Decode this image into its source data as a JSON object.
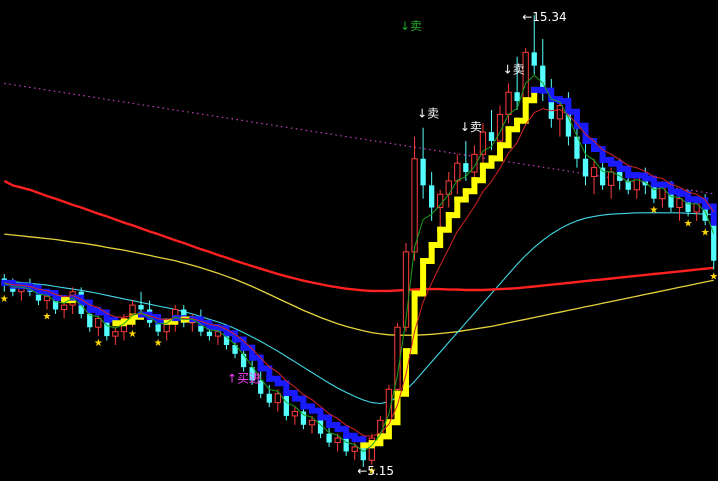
{
  "chart_data": {
    "type": "candlestick",
    "title": "",
    "xlabel": "",
    "ylabel": "",
    "grid": false,
    "axes_visible": false,
    "price_range": [
      4.9,
      15.5
    ],
    "colors": {
      "background": "#000000",
      "up_candle": "#ff3b3b",
      "down_candle": "#54ffff",
      "ma_red": "#ff2020",
      "ma_yellow": "#e6d23c",
      "ma_cyan": "#40d8e8",
      "ma_thin_red": "#d42424",
      "ma_green": "#1aa01a",
      "ma_magenta_dotted": "#c040c0",
      "trail_up": "#ffff00",
      "trail_down": "#1a1aff",
      "star": "#ffd700",
      "sell_signal_white": "#ffffff",
      "sell_signal_green": "#22aa22",
      "buy_signal": "#ff40ff"
    },
    "annotations": {
      "high_label": "15.34",
      "low_label": "5.15",
      "buy_label": "买进",
      "sell_label": "卖"
    },
    "candles": [
      [
        9.4,
        9.5,
        9.1,
        9.3
      ],
      [
        9.3,
        9.4,
        9.0,
        9.1
      ],
      [
        9.1,
        9.3,
        8.9,
        9.2
      ],
      [
        9.2,
        9.4,
        9.0,
        9.1
      ],
      [
        9.1,
        9.2,
        8.8,
        8.9
      ],
      [
        8.9,
        9.1,
        8.7,
        9.0
      ],
      [
        9.0,
        9.1,
        8.6,
        8.7
      ],
      [
        8.7,
        8.9,
        8.5,
        8.8
      ],
      [
        8.8,
        9.2,
        8.6,
        9.1
      ],
      [
        9.1,
        9.2,
        8.5,
        8.6
      ],
      [
        8.6,
        8.8,
        8.2,
        8.3
      ],
      [
        8.3,
        8.6,
        8.1,
        8.5
      ],
      [
        8.5,
        8.7,
        8.0,
        8.1
      ],
      [
        8.1,
        8.3,
        7.9,
        8.2
      ],
      [
        8.2,
        8.6,
        8.0,
        8.5
      ],
      [
        8.5,
        8.9,
        8.3,
        8.8
      ],
      [
        8.8,
        9.1,
        8.6,
        8.7
      ],
      [
        8.7,
        8.9,
        8.3,
        8.4
      ],
      [
        8.4,
        8.6,
        8.1,
        8.2
      ],
      [
        8.2,
        8.5,
        8.0,
        8.4
      ],
      [
        8.4,
        8.8,
        8.2,
        8.7
      ],
      [
        8.7,
        8.8,
        8.3,
        8.4
      ],
      [
        8.4,
        8.6,
        8.2,
        8.5
      ],
      [
        8.5,
        8.7,
        8.1,
        8.2
      ],
      [
        8.2,
        8.4,
        8.0,
        8.1
      ],
      [
        8.1,
        8.3,
        7.9,
        8.2
      ],
      [
        8.2,
        8.3,
        7.8,
        7.9
      ],
      [
        7.9,
        8.1,
        7.6,
        7.7
      ],
      [
        7.7,
        7.9,
        7.3,
        7.4
      ],
      [
        7.4,
        7.6,
        7.0,
        7.1
      ],
      [
        7.1,
        7.3,
        6.7,
        6.8
      ],
      [
        6.8,
        7.0,
        6.5,
        6.6
      ],
      [
        6.6,
        6.9,
        6.4,
        6.8
      ],
      [
        6.8,
        6.9,
        6.2,
        6.3
      ],
      [
        6.3,
        6.5,
        6.1,
        6.4
      ],
      [
        6.4,
        6.6,
        6.0,
        6.1
      ],
      [
        6.1,
        6.3,
        5.9,
        6.2
      ],
      [
        6.2,
        6.4,
        5.8,
        5.9
      ],
      [
        5.9,
        6.1,
        5.6,
        5.7
      ],
      [
        5.7,
        5.9,
        5.5,
        5.8
      ],
      [
        5.8,
        6.0,
        5.4,
        5.5
      ],
      [
        5.5,
        5.7,
        5.3,
        5.6
      ],
      [
        5.6,
        5.7,
        5.15,
        5.3
      ],
      [
        5.3,
        5.9,
        5.2,
        5.8
      ],
      [
        5.8,
        6.3,
        5.7,
        6.2
      ],
      [
        6.2,
        7.0,
        6.1,
        6.9
      ],
      [
        6.9,
        8.4,
        6.8,
        8.3
      ],
      [
        8.3,
        10.2,
        8.2,
        10.0
      ],
      [
        10.0,
        12.6,
        9.8,
        12.1
      ],
      [
        12.1,
        12.8,
        11.2,
        11.5
      ],
      [
        11.5,
        11.8,
        10.7,
        11.0
      ],
      [
        11.0,
        11.4,
        10.5,
        11.3
      ],
      [
        11.3,
        11.8,
        11.0,
        11.6
      ],
      [
        11.6,
        12.2,
        11.3,
        12.0
      ],
      [
        12.0,
        12.5,
        11.6,
        11.8
      ],
      [
        11.8,
        12.4,
        11.5,
        12.2
      ],
      [
        12.2,
        12.9,
        12.0,
        12.7
      ],
      [
        12.7,
        13.2,
        12.3,
        12.5
      ],
      [
        12.5,
        13.3,
        12.3,
        13.1
      ],
      [
        13.1,
        13.8,
        12.9,
        13.6
      ],
      [
        13.6,
        14.4,
        13.2,
        13.4
      ],
      [
        13.4,
        14.6,
        13.2,
        14.5
      ],
      [
        14.5,
        15.34,
        14.0,
        14.2
      ],
      [
        14.2,
        14.8,
        13.4,
        13.6
      ],
      [
        13.6,
        13.9,
        12.8,
        13.0
      ],
      [
        13.0,
        13.5,
        12.6,
        13.3
      ],
      [
        13.3,
        13.6,
        12.4,
        12.6
      ],
      [
        12.6,
        12.9,
        11.9,
        12.1
      ],
      [
        12.1,
        12.5,
        11.5,
        11.7
      ],
      [
        11.7,
        12.1,
        11.3,
        11.9
      ],
      [
        11.9,
        12.2,
        11.4,
        11.5
      ],
      [
        11.5,
        11.9,
        11.2,
        11.8
      ],
      [
        11.8,
        12.1,
        11.4,
        11.6
      ],
      [
        11.6,
        11.9,
        11.3,
        11.4
      ],
      [
        11.4,
        11.8,
        11.2,
        11.7
      ],
      [
        11.7,
        11.9,
        11.3,
        11.5
      ],
      [
        11.5,
        11.7,
        11.1,
        11.2
      ],
      [
        11.2,
        11.6,
        11.0,
        11.5
      ],
      [
        11.5,
        11.6,
        10.9,
        11.0
      ],
      [
        11.0,
        11.3,
        10.7,
        11.2
      ],
      [
        11.2,
        11.4,
        10.8,
        10.9
      ],
      [
        10.9,
        11.2,
        10.7,
        11.1
      ],
      [
        11.1,
        11.3,
        10.6,
        10.7
      ],
      [
        10.7,
        10.9,
        9.6,
        9.8
      ]
    ],
    "ma_red_values": [
      11.6,
      11.5,
      11.45,
      11.4,
      11.33,
      11.26,
      11.2,
      11.13,
      11.06,
      11.0,
      10.93,
      10.86,
      10.8,
      10.73,
      10.66,
      10.6,
      10.53,
      10.46,
      10.4,
      10.33,
      10.26,
      10.2,
      10.13,
      10.06,
      10.0,
      9.93,
      9.87,
      9.8,
      9.74,
      9.68,
      9.62,
      9.56,
      9.5,
      9.45,
      9.4,
      9.35,
      9.31,
      9.27,
      9.23,
      9.2,
      9.17,
      9.15,
      9.13,
      9.12,
      9.12,
      9.12,
      9.13,
      9.14,
      9.15,
      9.16,
      9.16,
      9.16,
      9.15,
      9.15,
      9.14,
      9.14,
      9.14,
      9.15,
      9.16,
      9.17,
      9.18,
      9.2,
      9.22,
      9.24,
      9.26,
      9.28,
      9.3,
      9.32,
      9.34,
      9.36,
      9.38,
      9.4,
      9.42,
      9.44,
      9.46,
      9.48,
      9.5,
      9.52,
      9.54,
      9.56,
      9.58,
      9.6,
      9.62,
      9.64
    ],
    "ma_yellow_values": [
      10.4,
      10.38,
      10.36,
      10.34,
      10.32,
      10.3,
      10.28,
      10.25,
      10.22,
      10.2,
      10.17,
      10.14,
      10.1,
      10.07,
      10.04,
      10.0,
      9.96,
      9.92,
      9.88,
      9.84,
      9.8,
      9.75,
      9.7,
      9.64,
      9.58,
      9.52,
      9.45,
      9.38,
      9.3,
      9.22,
      9.13,
      9.04,
      8.95,
      8.86,
      8.77,
      8.68,
      8.6,
      8.52,
      8.45,
      8.38,
      8.32,
      8.27,
      8.22,
      8.18,
      8.15,
      8.13,
      8.12,
      8.12,
      8.12,
      8.13,
      8.14,
      8.16,
      8.18,
      8.2,
      8.23,
      8.26,
      8.29,
      8.32,
      8.36,
      8.4,
      8.44,
      8.48,
      8.52,
      8.56,
      8.6,
      8.64,
      8.68,
      8.72,
      8.76,
      8.8,
      8.84,
      8.88,
      8.92,
      8.96,
      9.0,
      9.04,
      9.08,
      9.12,
      9.16,
      9.2,
      9.24,
      9.28,
      9.32,
      9.36
    ],
    "ma_cyan_values": [
      9.35,
      9.33,
      9.31,
      9.29,
      9.27,
      9.25,
      9.22,
      9.19,
      9.16,
      9.13,
      9.1,
      9.06,
      9.02,
      8.98,
      8.94,
      8.9,
      8.86,
      8.82,
      8.78,
      8.74,
      8.7,
      8.65,
      8.6,
      8.54,
      8.48,
      8.42,
      8.35,
      8.27,
      8.18,
      8.08,
      7.98,
      7.87,
      7.76,
      7.64,
      7.52,
      7.4,
      7.28,
      7.16,
      7.04,
      6.93,
      6.83,
      6.74,
      6.66,
      6.6,
      6.58,
      6.62,
      6.72,
      6.88,
      7.08,
      7.3,
      7.52,
      7.74,
      7.96,
      8.18,
      8.4,
      8.62,
      8.84,
      9.06,
      9.28,
      9.5,
      9.72,
      9.92,
      10.1,
      10.26,
      10.4,
      10.52,
      10.62,
      10.7,
      10.76,
      10.8,
      10.83,
      10.85,
      10.86,
      10.87,
      10.88,
      10.88,
      10.88,
      10.88,
      10.88,
      10.88,
      10.87,
      10.86,
      10.85,
      10.84
    ],
    "ma_magenta_values": [
      13.8,
      13.77,
      13.74,
      13.71,
      13.68,
      13.65,
      13.62,
      13.59,
      13.56,
      13.53,
      13.5,
      13.47,
      13.44,
      13.41,
      13.38,
      13.35,
      13.32,
      13.29,
      13.26,
      13.23,
      13.2,
      13.17,
      13.14,
      13.11,
      13.08,
      13.05,
      13.02,
      12.99,
      12.96,
      12.93,
      12.9,
      12.87,
      12.84,
      12.81,
      12.78,
      12.75,
      12.72,
      12.69,
      12.66,
      12.63,
      12.6,
      12.57,
      12.54,
      12.51,
      12.48,
      12.45,
      12.42,
      12.39,
      12.36,
      12.33,
      12.3,
      12.27,
      12.24,
      12.21,
      12.18,
      12.15,
      12.12,
      12.09,
      12.06,
      12.03,
      12.0,
      11.97,
      11.94,
      11.91,
      11.88,
      11.85,
      11.82,
      11.79,
      11.76,
      11.73,
      11.7,
      11.67,
      11.64,
      11.61,
      11.58,
      11.55,
      11.52,
      11.49,
      11.46,
      11.43,
      11.4,
      11.37,
      11.34,
      11.31
    ]
  }
}
